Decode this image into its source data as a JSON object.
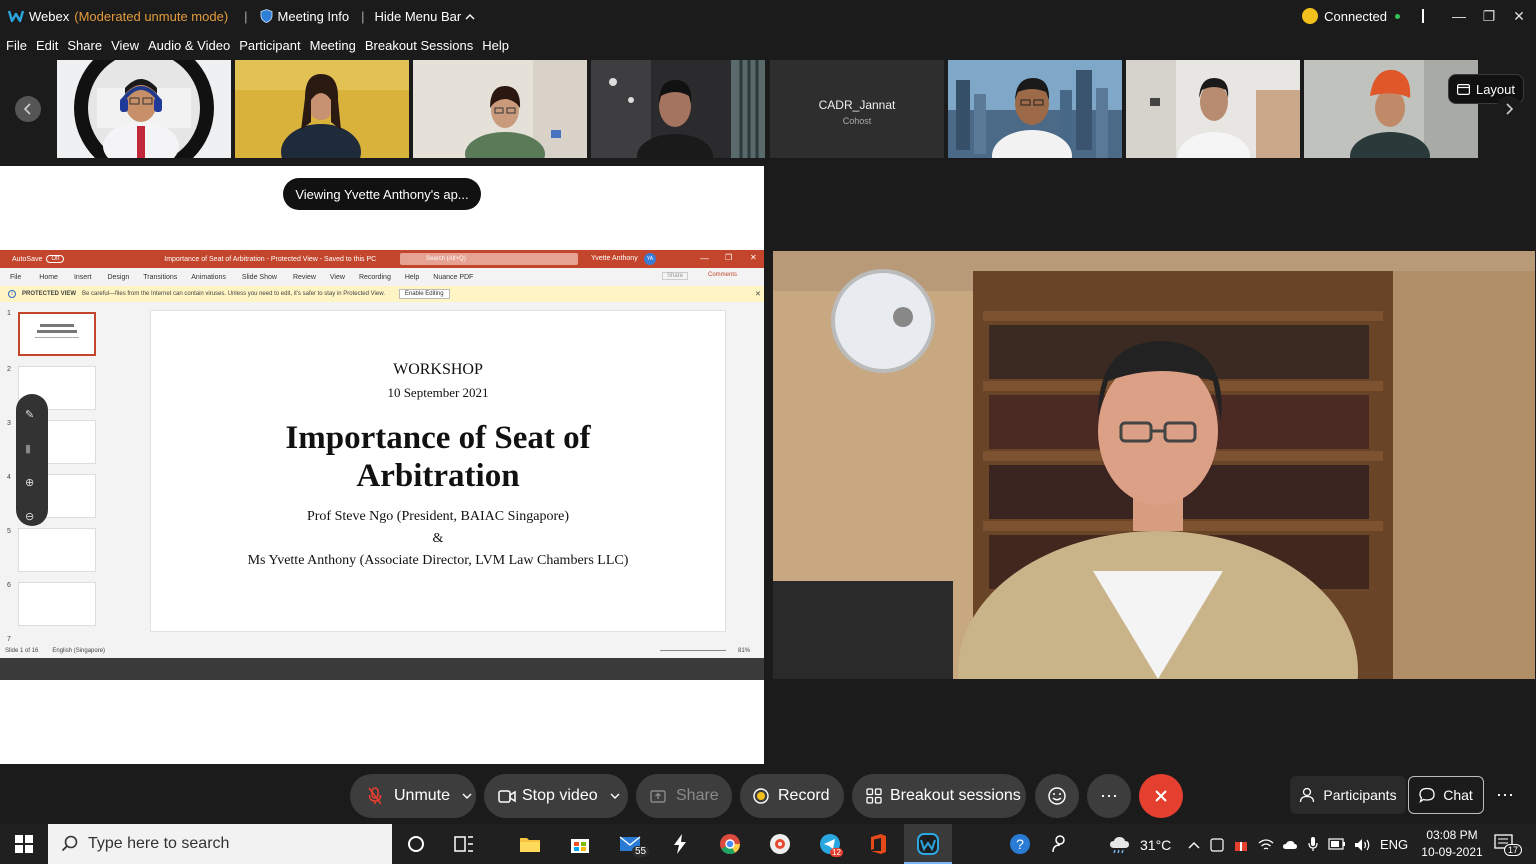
{
  "titlebar": {
    "app_name": "Webex",
    "mode": "(Moderated unmute mode)",
    "meeting_info": "Meeting Info",
    "hide_menu": "Hide Menu Bar",
    "status": "Connected"
  },
  "menu": [
    "File",
    "Edit",
    "Share",
    "View",
    "Audio & Video",
    "Participant",
    "Meeting",
    "Breakout Sessions",
    "Help"
  ],
  "participants_strip": {
    "cadr_name": "CADR_Jannat",
    "cadr_role": "Cohost",
    "layout_label": "Layout"
  },
  "share": {
    "viewing_label": "Viewing Yvette Anthony's ap...",
    "ppt_title": "Importance of Seat of Arbitration  -  Protected View  -  Saved to this PC",
    "ppt_autosave": "AutoSave",
    "ppt_autosave_state": "Off",
    "ppt_search": "Search (Alt+Q)",
    "ppt_user": "Yvette Anthony",
    "ppt_user_initials": "YA",
    "ppt_tabs": [
      "File",
      "Home",
      "Insert",
      "Design",
      "Transitions",
      "Animations",
      "Slide Show",
      "Review",
      "View",
      "Recording",
      "Help",
      "Nuance PDF"
    ],
    "ppt_share": "Share",
    "ppt_comments": "Comments",
    "protected_label": "PROTECTED VIEW",
    "protected_text": "Be careful—files from the Internet can contain viruses. Unless you need to edit, it's safer to stay in Protected View.",
    "enable_editing": "Enable Editing",
    "slide_numbers": [
      "1",
      "2",
      "3",
      "4",
      "5",
      "6",
      "7"
    ],
    "slide": {
      "workshop": "WORKSHOP",
      "date": "10 September 2021",
      "title_line1": "Importance of Seat of",
      "title_line2": "Arbitration",
      "speaker1": "Prof Steve Ngo (President, BAIAC Singapore)",
      "amp": "&",
      "speaker2": "Ms Yvette Anthony (Associate Director, LVM Law Chambers LLC)"
    },
    "status_slide": "Slide 1 of 16",
    "status_lang": "English (Singapore)",
    "zoom": "81%"
  },
  "controls": {
    "unmute": "Unmute",
    "stop_video": "Stop video",
    "share": "Share",
    "record": "Record",
    "breakout": "Breakout sessions",
    "participants": "Participants",
    "chat": "Chat"
  },
  "taskbar": {
    "search_placeholder": "Type here to search",
    "mail_badge": "55",
    "telegram_badge": "12",
    "weather": "31°C",
    "lang": "ENG",
    "time": "03:08 PM",
    "date": "10-09-2021",
    "notif_count": "17"
  },
  "colors": {
    "accent_end": "#e43f2f",
    "ppt_red": "#c3452c",
    "connected_green": "#37c25b"
  }
}
